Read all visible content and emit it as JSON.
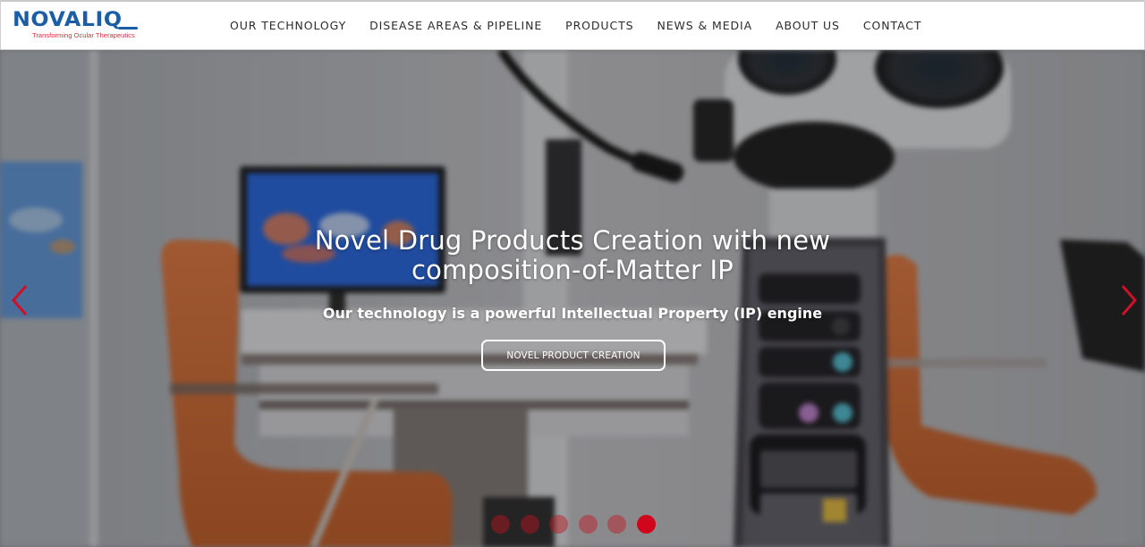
{
  "brand": {
    "name": "NOVALIQ",
    "tagline": "Transforming Ocular Therapeutics",
    "primary_color": "#1b5ea5",
    "accent_color": "#d1323b"
  },
  "nav": {
    "items": [
      {
        "label": "OUR TECHNOLOGY"
      },
      {
        "label": "DISEASE AREAS & PIPELINE"
      },
      {
        "label": "PRODUCTS"
      },
      {
        "label": "NEWS & MEDIA"
      },
      {
        "label": "ABOUT US"
      },
      {
        "label": "CONTACT"
      }
    ]
  },
  "hero": {
    "title_line1": "Novel Drug Products Creation with new",
    "title_line2": "composition-of-Matter IP",
    "subtitle": "Our technology is a powerful Intellectual Property (IP) engine",
    "cta_label": "NOVEL PRODUCT CREATION",
    "prev_icon": "chevron-left-icon",
    "next_icon": "chevron-right-icon",
    "arrow_color": "#d0102a",
    "slides": {
      "count": 6,
      "active_index": 5,
      "active_color": "#d0061c",
      "inactive_color": "rgba(190,20,30,0.45)"
    }
  }
}
